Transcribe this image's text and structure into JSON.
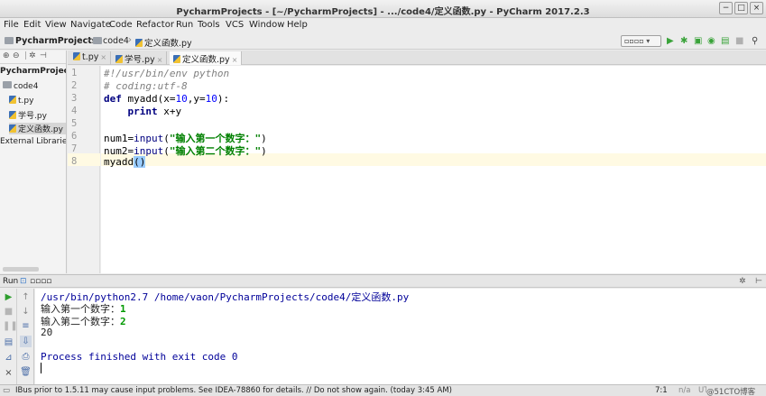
{
  "window": {
    "title": "PycharmProjects - [~/PycharmProjects] - .../code4/定义函数.py - PyCharm 2017.2.3",
    "controls": [
      "−",
      "□",
      "×"
    ]
  },
  "menu": [
    "File",
    "Edit",
    "View",
    "Navigate",
    "Code",
    "Refactor",
    "Run",
    "Tools",
    "VCS",
    "Window",
    "Help"
  ],
  "breadcrumb": {
    "project": "PycharmProjects",
    "folder": "code4",
    "file": "定义函数.py"
  },
  "run_config": "▫▫▫▫",
  "toolbar_icons": [
    "run-icon",
    "debug-icon",
    "coverage-icon",
    "profile-icon",
    "concurrency-icon",
    "stop-icon",
    "search-icon"
  ],
  "project_panel": {
    "root": "PycharmProjects",
    "folder": "code4",
    "files": [
      "t.py",
      "学号.py",
      "定义函数.py"
    ],
    "selected": "定义函数.py",
    "external": "External Libraries"
  },
  "editor": {
    "tabs": [
      "t.py",
      "学号.py",
      "定义函数.py"
    ],
    "active_tab": "定义函数.py",
    "line_numbers": [
      "1",
      "2",
      "3",
      "4",
      "5",
      "6",
      "7",
      "8"
    ],
    "current_line": "8"
  },
  "run_panel": {
    "label": "Run",
    "config": "▫▫▫▫",
    "lines": {
      "cmd": "/usr/bin/python2.7 /home/vaon/PycharmProjects/code4/定义函数.py",
      "prompt1": "输入第一个数字：",
      "answer1": "1",
      "prompt2": "输入第二个数字：",
      "answer2": "2",
      "result": "20",
      "exit": "Process finished with exit code 0"
    }
  },
  "status": {
    "message": "IBus prior to 1.5.11 may cause input problems. See IDEA-78860 for details. // Do not show again. (today 3:45 AM)",
    "position": "7:1",
    "na": "n/a",
    "encoding": "UTF-8"
  },
  "watermark": "@51CTO博客"
}
